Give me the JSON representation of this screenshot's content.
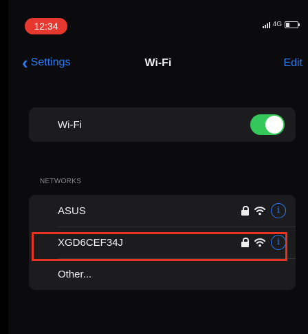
{
  "status_bar": {
    "time": "12:34",
    "network": "4G"
  },
  "nav": {
    "back_label": "Settings",
    "title": "Wi-Fi",
    "edit_label": "Edit"
  },
  "wifi_toggle": {
    "label": "Wi-Fi",
    "state": "on"
  },
  "networks": {
    "section_label": "NETWORKS",
    "items": [
      {
        "name": "ASUS",
        "secured": true
      },
      {
        "name": "XGD6CEF34J",
        "secured": true,
        "highlighted": true
      },
      {
        "name": "Other..."
      }
    ]
  },
  "colors": {
    "accent": "#2b7cf6",
    "toggle_on": "#34c759",
    "highlight": "#e5341f",
    "time_pill": "#e7382f"
  }
}
